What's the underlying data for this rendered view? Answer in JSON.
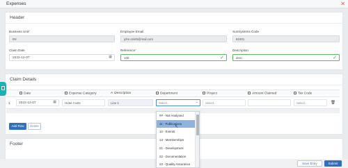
{
  "window": {
    "title": "Expenses",
    "close_icon": "close-icon"
  },
  "header": {
    "title": "Header",
    "business_unit": {
      "label": "Business Unit",
      "value": "INI"
    },
    "employee_email": {
      "label": "Employee Email",
      "value": "john.smith@mail.com"
    },
    "sunsystems_code": {
      "label": "SunSystems Code",
      "value": "81001"
    },
    "claim_date": {
      "label": "Claim Date",
      "value": "2022-12-07"
    },
    "reference": {
      "label": "Reference",
      "value": "100"
    },
    "description": {
      "label": "Description",
      "value": "desc"
    }
  },
  "claim_details": {
    "title": "Claim Details",
    "columns": [
      "",
      "Date",
      "Expense Category",
      "Description",
      "Department",
      "Project",
      "Amount Claimed",
      "Tax Code"
    ],
    "row": {
      "index": "1",
      "date": "2022-12-07",
      "category": "Hotel Costs",
      "description": "Line 1",
      "department_placeholder": "Select...",
      "project_placeholder": "Select...",
      "tax_placeholder": "Select..."
    },
    "add_row_label": "Add Row",
    "delete_label": "Delete"
  },
  "department_options": [
    "## - Not Analysed",
    "11 - Publications",
    "12 - Events",
    "13 - Memberships",
    "21 - Development",
    "22 - Documentation",
    "23 - Quality Assurance"
  ],
  "highlighted_option_index": 1,
  "footer": {
    "title": "Footer"
  },
  "actions": {
    "save_entry": "Save Entry",
    "submit": "Submit"
  },
  "colors": {
    "accent": "#2f6fbd",
    "valid": "#28a745",
    "side_tab": "#1ab0b4",
    "highlight": "#8db4e0"
  }
}
